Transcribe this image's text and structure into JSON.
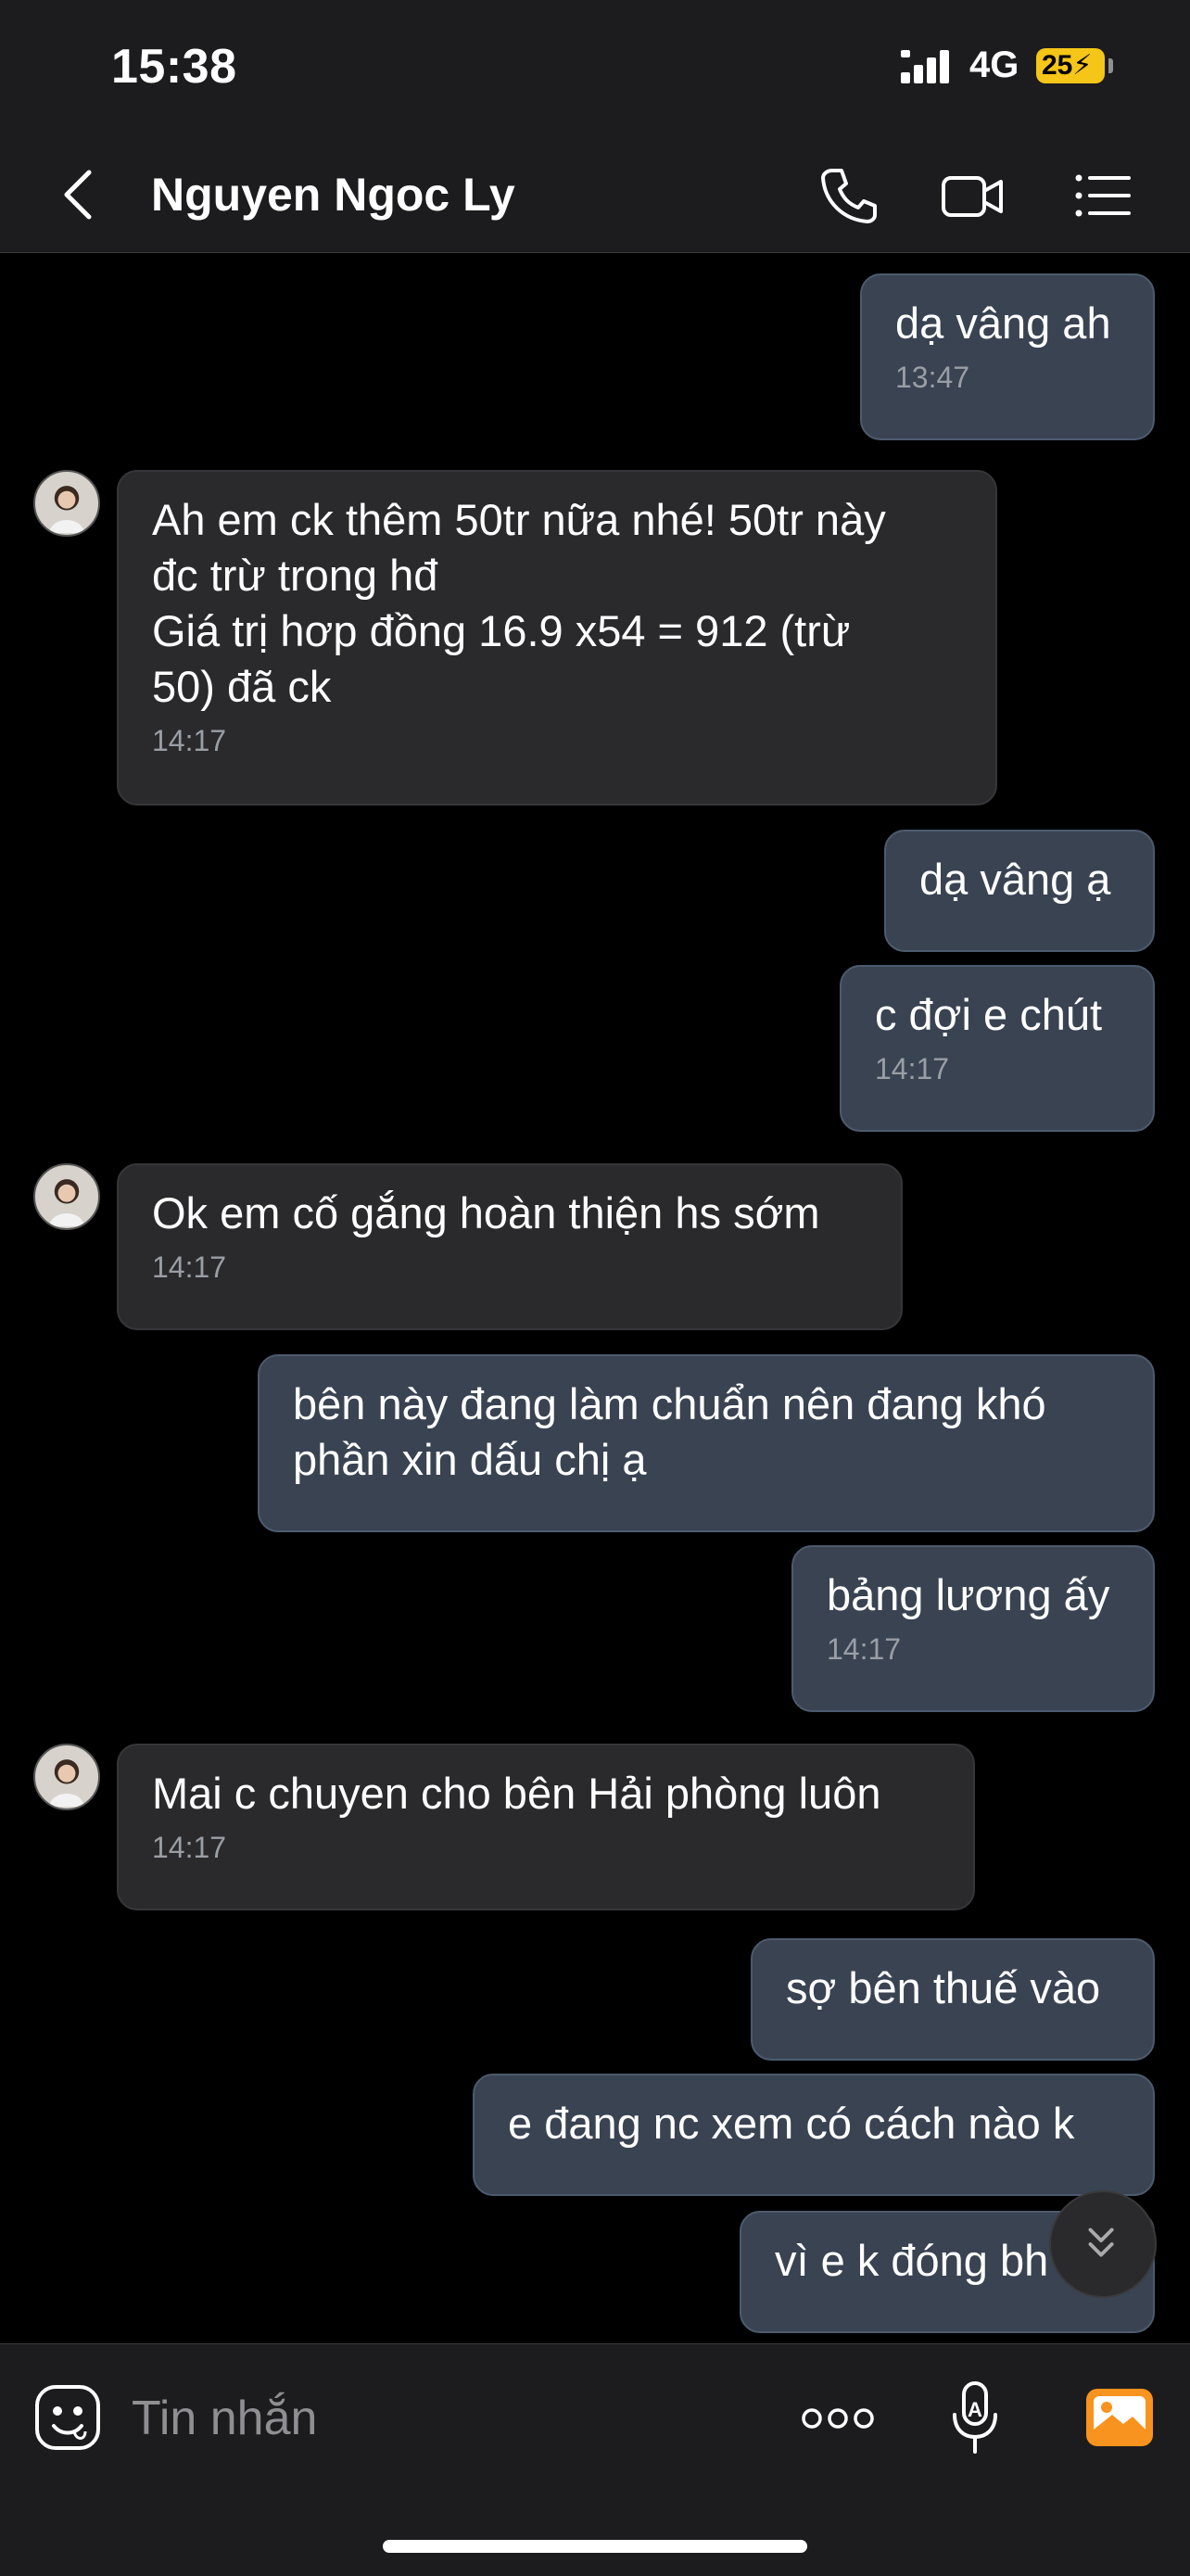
{
  "status_bar": {
    "time": "15:38",
    "network": "4G",
    "battery": "25"
  },
  "header": {
    "contact_name": "Nguyen Ngoc Ly"
  },
  "messages": [
    {
      "from": "me",
      "text": "dạ vâng ah",
      "time": "13:47"
    },
    {
      "from": "contact",
      "text": "Ah em ck thêm 50tr nữa nhé! 50tr này\nđc trừ trong hđ\nGiá trị hơp đồng 16.9 x54 = 912 (trừ\n50) đã ck",
      "time": "14:17"
    },
    {
      "from": "me",
      "text": "dạ vâng ạ",
      "time": ""
    },
    {
      "from": "me",
      "text": "c đợi e chút",
      "time": "14:17"
    },
    {
      "from": "contact",
      "text": "Ok em cố gắng hoàn thiện hs sớm",
      "time": "14:17"
    },
    {
      "from": "me",
      "text": "bên này đang làm chuẩn nên đang khó\nphần xin dấu chị ạ",
      "time": ""
    },
    {
      "from": "me",
      "text": "bảng lương ấy",
      "time": "14:17"
    },
    {
      "from": "contact",
      "text": "Mai c chuyen cho bên Hải phòng luôn",
      "time": "14:17"
    },
    {
      "from": "me",
      "text": "sợ bên thuế vào",
      "time": ""
    },
    {
      "from": "me",
      "text": "e đang nc xem có cách nào k",
      "time": ""
    },
    {
      "from": "me",
      "text": "vì e k đóng bh",
      "time": ""
    }
  ],
  "composer": {
    "placeholder": "Tin nhắn"
  },
  "icons": {
    "back": "chevron-left-icon",
    "phone": "phone-icon",
    "video": "video-camera-icon",
    "menu": "list-menu-icon",
    "sticker": "sticker-smile-icon",
    "more": "more-dots-icon",
    "mic": "microphone-icon",
    "gallery": "image-gallery-icon",
    "scroll": "double-chevron-down-icon"
  },
  "colors": {
    "sent_bubble": "#394352",
    "received_bubble": "#2a2a2c",
    "gallery_accent": "#f7931e",
    "battery": "#f5c518"
  }
}
